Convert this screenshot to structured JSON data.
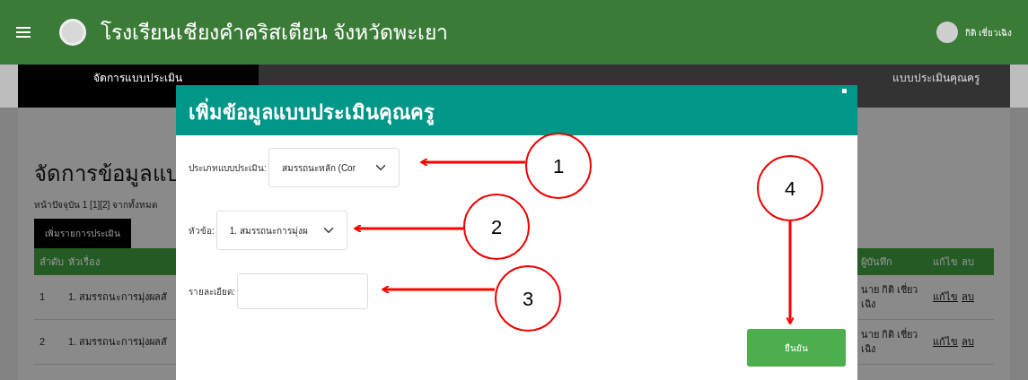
{
  "navbar": {
    "title": "โรงเรียนเชียงคำคริสเตียน จังหวัดพะเยา",
    "user_name": "กิติ เชี่ยวเฉิง"
  },
  "tabs": [
    {
      "label": "จัดการแบบประเมิน",
      "selected": true
    },
    {
      "selected": false
    },
    {
      "selected": false
    },
    {
      "label": "แบบประเมินคุณครู",
      "selected": false
    }
  ],
  "page": {
    "heading": "จัดการข้อมูลแบ",
    "pagination": "หน้าปัจจุบัน 1 [1][2] จากทั้งหมด",
    "add_button": "เพิ่มรายการประเมิน"
  },
  "table": {
    "columns": [
      "ลำดับ",
      "หัวเรื่อง",
      "ผู้บันทึก",
      "แก้ไข",
      "ลบ"
    ],
    "rows": [
      {
        "number": "1",
        "topic": "1. สมรรถนะการมุ่งผลสั",
        "recorder": "นาย กิติ เชี่ยว เฉิง",
        "edit": "แก้ไข",
        "delete": "ลบ"
      },
      {
        "number": "2",
        "topic": "1. สมรรถนะการมุ่งผลสั",
        "recorder": "นาย กิติ เชี่ยว เฉิง",
        "edit": "แก้ไข",
        "delete": "ลบ"
      }
    ]
  },
  "modal": {
    "title": "เพิ่มข้อมูลแบบประเมินคุณครู",
    "fields": [
      {
        "kind": "select",
        "label": "ประเภทแบบประเมิน:",
        "value": "สมรรถนะหลัก (Cor"
      },
      {
        "kind": "select",
        "label": "หัวข้อ:",
        "value": "1. สมรรถนะการมุ่งผ"
      },
      {
        "kind": "text",
        "label": "รายละเอียด:"
      }
    ],
    "confirm_button": "ยืนยัน"
  },
  "annotations": [
    {
      "number": "1"
    },
    {
      "number": "2"
    },
    {
      "number": "3"
    },
    {
      "number": "4"
    }
  ]
}
